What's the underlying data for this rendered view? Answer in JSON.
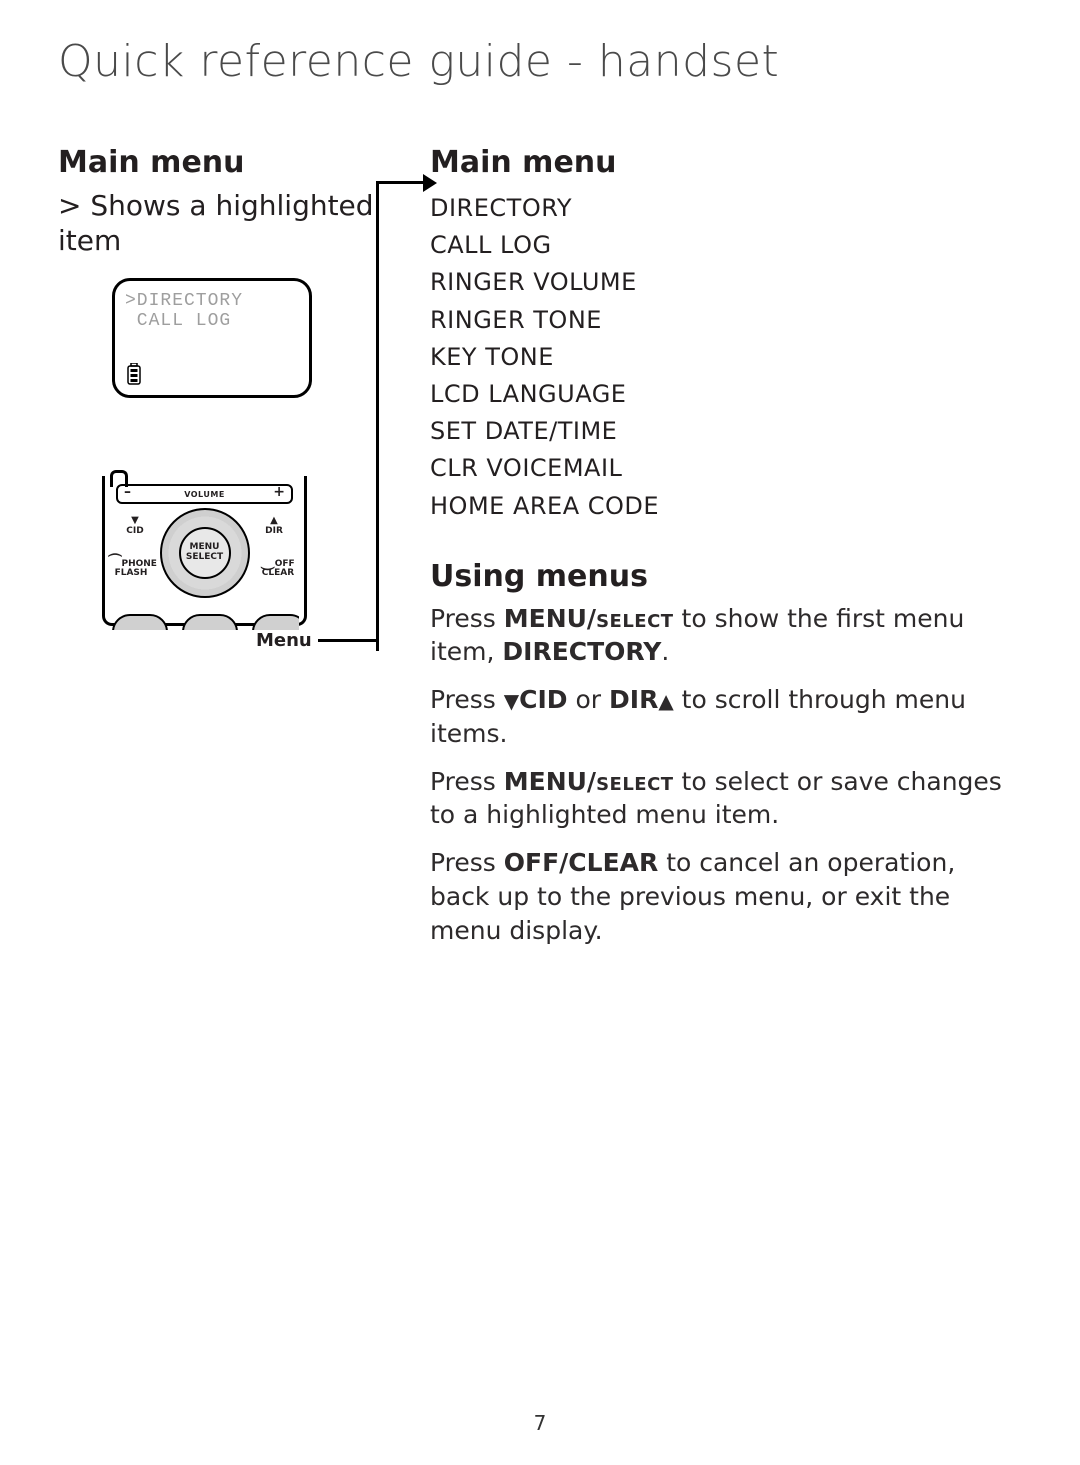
{
  "page": {
    "title": "Quick reference guide - handset",
    "number": "7"
  },
  "left": {
    "heading": "Main menu",
    "caption": "> Shows a highlighted item",
    "lcd": {
      "line1": ">DIRECTORY",
      "line2": " CALL LOG"
    },
    "keypad": {
      "volume_label": "VOLUME",
      "minus": "–",
      "plus": "+",
      "cid": "CID",
      "dir": "DIR",
      "phone1": "PHONE",
      "phone2": "FLASH",
      "off1": "OFF",
      "off2": "CLEAR",
      "menu": "MENU",
      "select": "SELECT"
    },
    "menu_callout": "Menu"
  },
  "right": {
    "heading": "Main menu",
    "menu_items": [
      "DIRECTORY",
      "CALL LOG",
      "RINGER VOLUME",
      "RINGER TONE",
      "KEY TONE",
      "LCD LANGUAGE",
      "SET DATE/TIME",
      "CLR VOICEMAIL",
      "HOME AREA CODE"
    ],
    "using_heading": "Using menus",
    "p1a": "Press ",
    "p1b": "MENU/",
    "p1c": "select",
    "p1d": " to show the first menu item, ",
    "p1e": "DIRECTORY",
    "p1f": ".",
    "p2a": "Press ",
    "p2b": "CID",
    "p2c": " or ",
    "p2d": "DIR",
    "p2e": " to scroll through menu items.",
    "p3a": "Press ",
    "p3b": "MENU/",
    "p3c": "select",
    "p3d": " to select or save changes to a highlighted menu item.",
    "p4a": "Press ",
    "p4b": "OFF/CLEAR",
    "p4c": " to cancel an operation, back up to the previous menu, or exit the menu display."
  }
}
